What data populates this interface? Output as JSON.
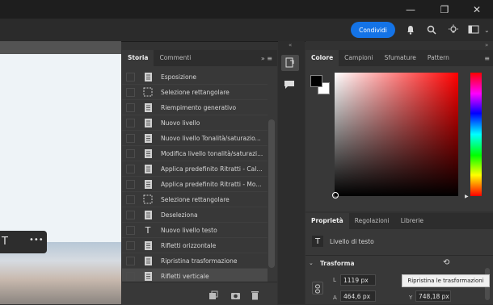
{
  "window": {
    "minimize": "—",
    "restore": "❐",
    "close": "✕"
  },
  "toolbar": {
    "share_label": "Condividi"
  },
  "icons": [
    "bell-icon",
    "search-icon",
    "lightbulb-icon",
    "screen-mode-icon"
  ],
  "canvas": {
    "more_label": "•••",
    "text_tool_glyph": "T"
  },
  "history": {
    "tabs": [
      "Storia",
      "Commenti"
    ],
    "items": [
      {
        "label": "Esposizione",
        "icon": "doc"
      },
      {
        "label": "Selezione rettangolare",
        "icon": "marquee"
      },
      {
        "label": "Riempimento generativo",
        "icon": "doc"
      },
      {
        "label": "Nuovo livello",
        "icon": "doc"
      },
      {
        "label": "Nuovo livello Tonalità/saturazio...",
        "icon": "doc"
      },
      {
        "label": "Modifica livello tonalità/saturazi...",
        "icon": "doc"
      },
      {
        "label": "Applica predefinito Ritratti - Cal...",
        "icon": "doc"
      },
      {
        "label": "Applica predefinito Ritratti - Mo...",
        "icon": "doc"
      },
      {
        "label": "Selezione rettangolare",
        "icon": "marquee"
      },
      {
        "label": "Deseleziona",
        "icon": "doc"
      },
      {
        "label": "Nuovo livello testo",
        "icon": "text"
      },
      {
        "label": "Rifletti orizzontale",
        "icon": "doc"
      },
      {
        "label": "Ripristina trasformazione",
        "icon": "doc"
      },
      {
        "label": "Rifletti verticale",
        "icon": "doc"
      }
    ]
  },
  "color_panel": {
    "tabs": [
      "Colore",
      "Campioni",
      "Sfumature",
      "Pattern"
    ]
  },
  "properties_panel": {
    "tabs": [
      "Proprietà",
      "Regolazioni",
      "Librerie"
    ],
    "layer_type": "Livello di testo",
    "section": "Trasforma",
    "w_label": "L",
    "w_value": "1119 px",
    "x_label": "A",
    "x_value": "464,6 px",
    "y_label": "Y",
    "y_value": "748,18 px",
    "tooltip": "Ripristina le trasformazioni"
  }
}
